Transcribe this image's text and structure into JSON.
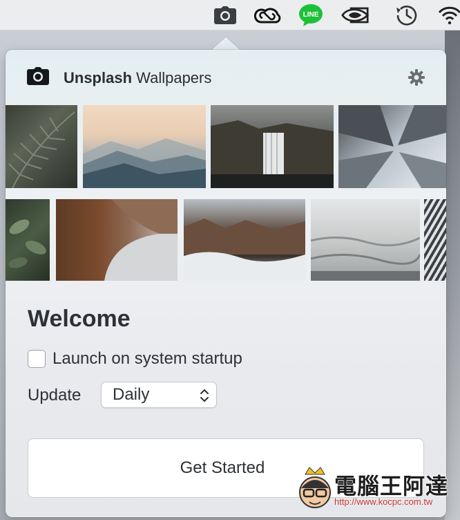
{
  "menubar": {
    "icons": [
      "camera-icon",
      "creative-cloud-icon",
      "line-icon",
      "nvidia-icon",
      "time-machine-icon",
      "wifi-icon"
    ],
    "line_label": "LINE"
  },
  "popover": {
    "title_bold": "Unsplash",
    "title_rest": " Wallpapers",
    "welcome": "Welcome",
    "launch_label": "Launch on system startup",
    "launch_checked": false,
    "update_label": "Update",
    "update_value": "Daily",
    "cta_label": "Get Started"
  },
  "watermark": {
    "text": "電腦王阿達",
    "url": "http://www.kocpc.com.tw"
  },
  "colors": {
    "menubar": "#ecedef",
    "text": "#2d3136",
    "line_green": "#1ec03a"
  }
}
